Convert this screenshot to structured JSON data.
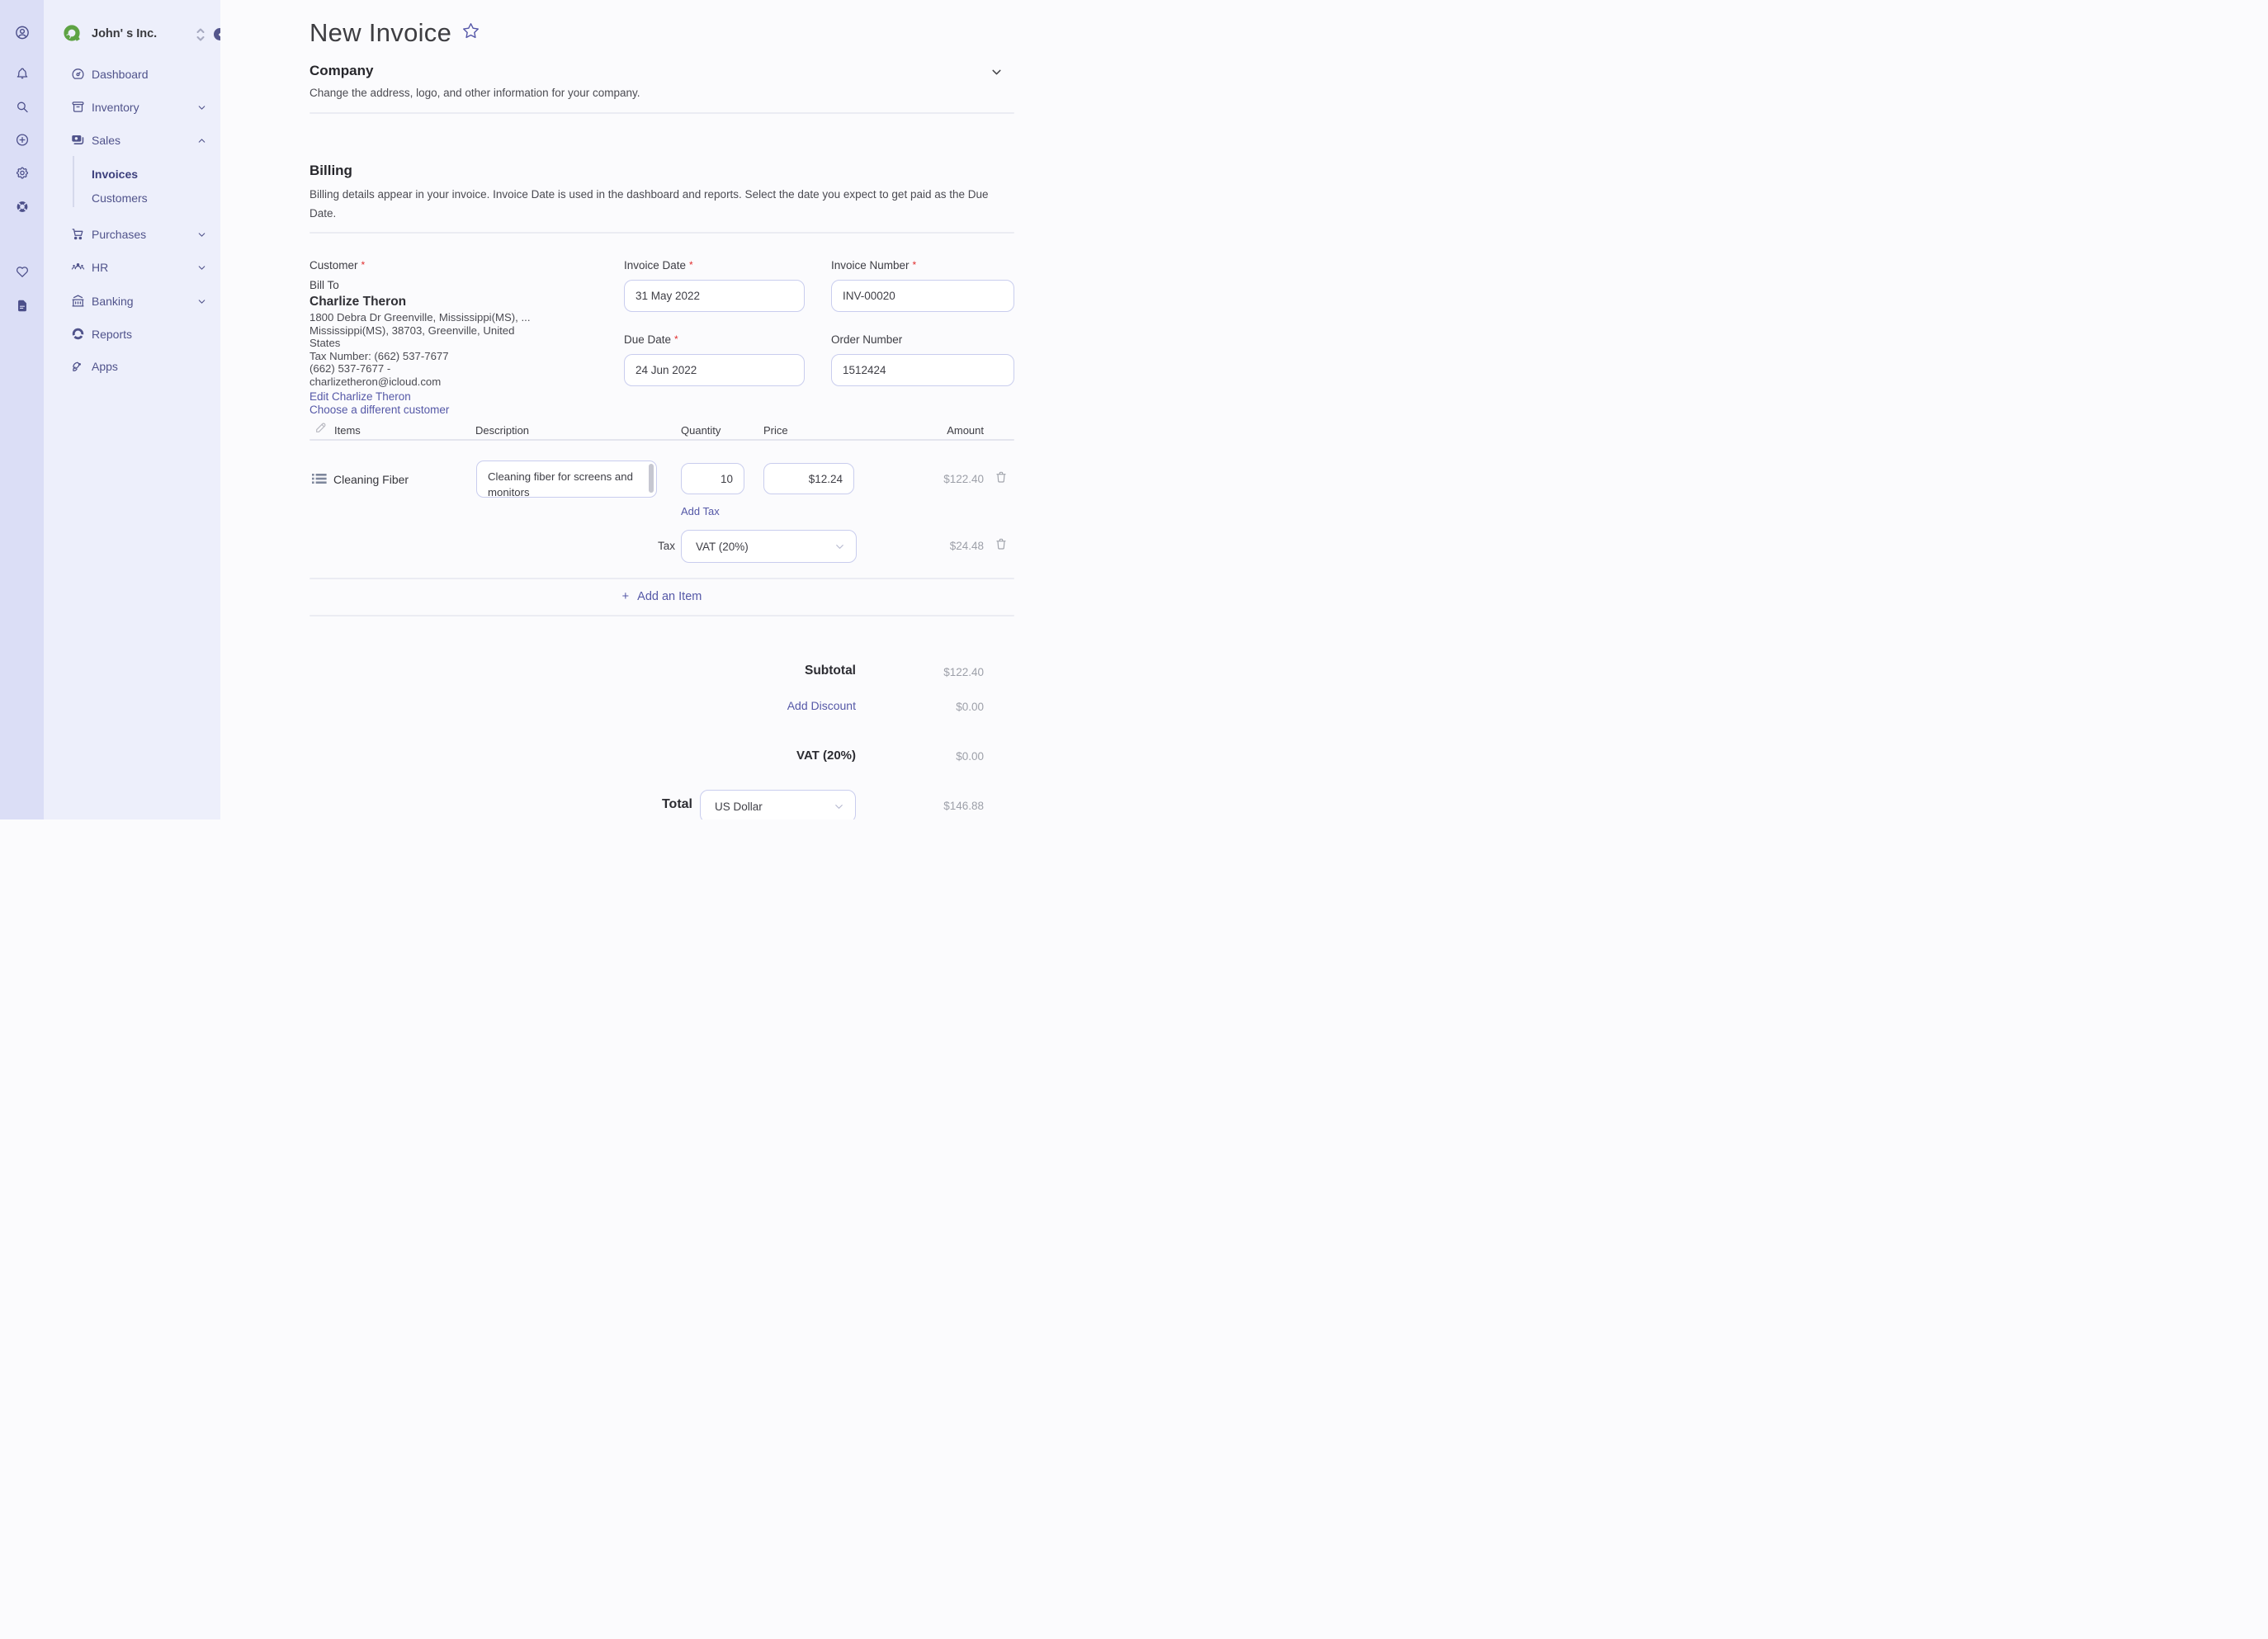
{
  "colors": {
    "accent_purple": "#5558a7",
    "icon_purple": "#4c4f8a",
    "logo_green": "#5ea344",
    "required_red": "#e12d2d",
    "rail_bg": "#dbdef6",
    "sidebar_bg": "#edeffb"
  },
  "rail": {
    "icons": [
      "account",
      "notifications",
      "search",
      "create-new",
      "settings",
      "support",
      "favorites",
      "documents"
    ]
  },
  "sidebar": {
    "company_name": "John' s Inc.",
    "nav": [
      {
        "label": "Dashboard",
        "icon": "gauge"
      },
      {
        "label": "Inventory",
        "icon": "box",
        "chevron": "down"
      },
      {
        "label": "Sales",
        "icon": "money",
        "chevron": "up"
      },
      {
        "label": "Invoices",
        "child": true,
        "active": true
      },
      {
        "label": "Customers",
        "child": true
      },
      {
        "label": "Purchases",
        "icon": "cart",
        "chevron": "down"
      },
      {
        "label": "HR",
        "icon": "users",
        "chevron": "down"
      },
      {
        "label": "Banking",
        "icon": "bank",
        "chevron": "down"
      },
      {
        "label": "Reports",
        "icon": "chart-donut"
      },
      {
        "label": "Apps",
        "icon": "rocket"
      }
    ]
  },
  "page": {
    "title": "New Invoice"
  },
  "company_section": {
    "title": "Company",
    "description": "Change the address, logo, and other information for your company."
  },
  "billing_section": {
    "title": "Billing",
    "description": "Billing details appear in your invoice. Invoice Date is used in the dashboard and reports. Select the date you expect to get paid as the Due Date."
  },
  "required_marker": "*",
  "customer": {
    "label": "Customer",
    "bill_to": "Bill To",
    "name": "Charlize Theron",
    "address_line1": "1800 Debra Dr Greenville, Mississippi(MS),  ...",
    "address_line2": "Mississippi(MS), 38703, Greenville, United",
    "address_line3": "States",
    "tax_number": "Tax Number: (662) 537-7677",
    "phone": "(662) 537-7677   -",
    "email": "charlizetheron@icloud.com",
    "edit_link": "Edit Charlize Theron",
    "choose_link": "Choose a different customer"
  },
  "fields": {
    "invoice_date": {
      "label": "Invoice Date",
      "value": "31 May 2022",
      "required": true
    },
    "invoice_number": {
      "label": "Invoice Number",
      "value": "INV-00020",
      "required": true
    },
    "due_date": {
      "label": "Due Date",
      "value": "24 Jun 2022",
      "required": true
    },
    "order_number": {
      "label": "Order Number",
      "value": "1512424",
      "required": false
    }
  },
  "items_table": {
    "headers": {
      "items": "Items",
      "description": "Description",
      "quantity": "Quantity",
      "price": "Price",
      "amount": "Amount"
    },
    "row": {
      "name": "Cleaning Fiber",
      "description": "Cleaning fiber for screens and monitors",
      "quantity": "10",
      "price": "$12.24",
      "amount": "$122.40"
    },
    "add_tax_label": "Add Tax",
    "tax": {
      "label": "Tax",
      "value": "VAT (20%)",
      "amount": "$24.48"
    },
    "add_item_plus": "+",
    "add_item_label": "Add an Item"
  },
  "totals": {
    "subtotal": {
      "label": "Subtotal",
      "amount": "$122.40"
    },
    "discount": {
      "label": "Add Discount",
      "amount": "$0.00"
    },
    "vat": {
      "label": "VAT (20%)",
      "amount": "$0.00"
    },
    "total": {
      "label": "Total",
      "currency": "US Dollar",
      "amount": "$146.88"
    }
  }
}
